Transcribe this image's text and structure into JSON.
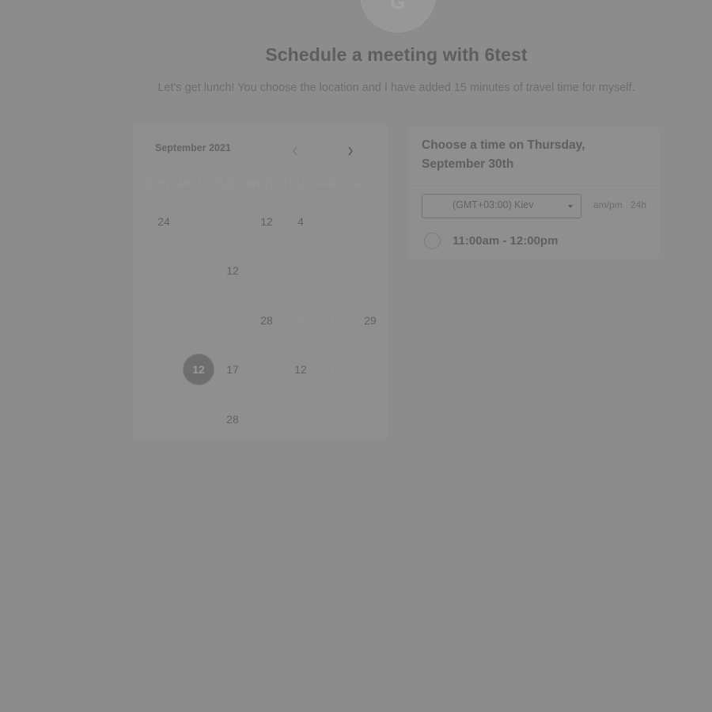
{
  "avatar": {
    "initial": "G"
  },
  "page": {
    "title": "Schedule a meeting with 6test",
    "subtitle": "Let's get lunch! You choose the location and I have added 15 minutes of travel time for myself."
  },
  "calendar": {
    "month_label": "September 2021",
    "weekdays": [
      "SUN",
      "MON",
      "TUE",
      "WED",
      "THU",
      "FRI",
      "SAT"
    ],
    "weeks": [
      [
        {
          "label": "24",
          "state": "available"
        },
        {
          "label": "2",
          "state": "muted"
        },
        {
          "label": "3",
          "state": "muted"
        },
        {
          "label": "12",
          "state": "available"
        },
        {
          "label": "4",
          "state": "available"
        },
        {
          "label": "2",
          "state": "muted"
        },
        {
          "label": "2",
          "state": "muted"
        }
      ],
      [
        {
          "label": "26",
          "state": "muted"
        },
        {
          "label": "10",
          "state": "muted"
        },
        {
          "label": "12",
          "state": "available"
        },
        {
          "label": "13",
          "state": "muted"
        },
        {
          "label": "20",
          "state": "muted"
        },
        {
          "label": "24",
          "state": "muted"
        },
        {
          "label": "16",
          "state": "muted"
        }
      ],
      [
        {
          "label": "21",
          "state": "muted"
        },
        {
          "label": "2",
          "state": "muted"
        },
        {
          "label": "3",
          "state": "muted"
        },
        {
          "label": "28",
          "state": "available"
        },
        {
          "label": "30",
          "state": "muted"
        },
        {
          "label": "12",
          "state": "muted"
        },
        {
          "label": "29",
          "state": "available"
        }
      ],
      [
        {
          "label": "13",
          "state": "muted"
        },
        {
          "label": "12",
          "state": "selected"
        },
        {
          "label": "17",
          "state": "available"
        },
        {
          "label": "4",
          "state": "muted"
        },
        {
          "label": "12",
          "state": "available"
        },
        {
          "label": "13",
          "state": "muted"
        },
        {
          "label": "3",
          "state": "muted"
        }
      ],
      [
        {
          "label": "12",
          "state": "muted"
        },
        {
          "label": "2",
          "state": "muted"
        },
        {
          "label": "28",
          "state": "available"
        },
        {
          "label": "20",
          "state": "muted"
        },
        {
          "label": "22",
          "state": "muted"
        },
        {
          "label": "22",
          "state": "muted"
        },
        {
          "label": "31",
          "state": "muted"
        }
      ]
    ]
  },
  "times": {
    "heading": "Choose a time on Thursday, September 30th",
    "timezone": "(GMT+03:00) Kiev",
    "format_ampm": "am/pm",
    "format_24h": "24h",
    "slots": [
      {
        "label": "11:00am - 12:00pm"
      }
    ]
  },
  "icons": {
    "prev": "chevron-left-icon",
    "next": "chevron-right-icon",
    "caret": "caret-down-icon"
  }
}
